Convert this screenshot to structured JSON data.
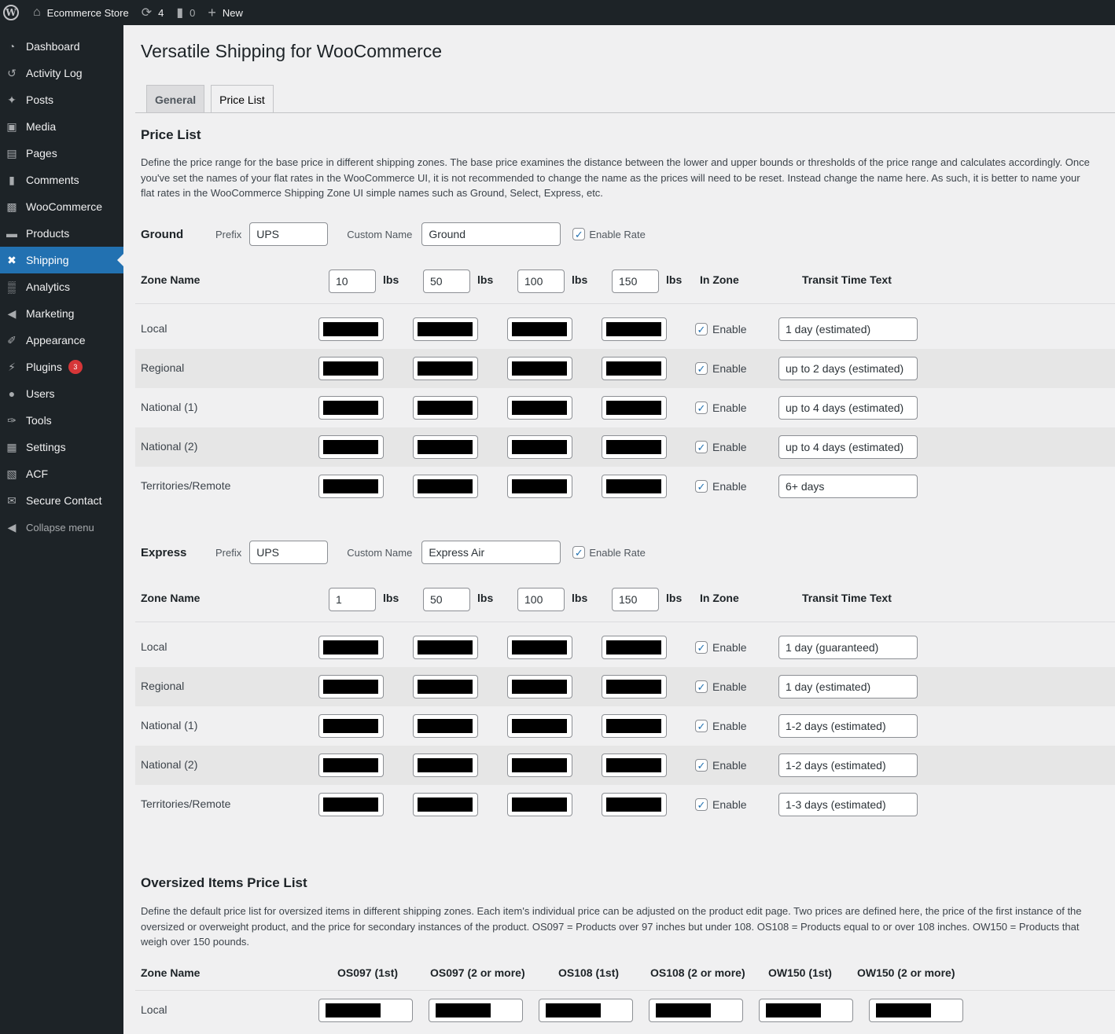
{
  "adminbar": {
    "site_name": "Ecommerce Store",
    "updates_count": "4",
    "comments_count": "0",
    "new_label": "New"
  },
  "sidebar": {
    "items": [
      {
        "label": "Dashboard",
        "icon": "dashboard-icon"
      },
      {
        "label": "Activity Log",
        "icon": "history-icon"
      },
      {
        "label": "Posts",
        "icon": "pushpin-icon"
      },
      {
        "label": "Media",
        "icon": "media-icon"
      },
      {
        "label": "Pages",
        "icon": "pages-icon"
      },
      {
        "label": "Comments",
        "icon": "comment-icon"
      },
      {
        "label": "WooCommerce",
        "icon": "woo-icon"
      },
      {
        "label": "Products",
        "icon": "archive-icon"
      },
      {
        "label": "Shipping",
        "icon": "airplane-icon",
        "current": true
      },
      {
        "label": "Analytics",
        "icon": "bar-chart-icon"
      },
      {
        "label": "Marketing",
        "icon": "megaphone-icon"
      },
      {
        "label": "Appearance",
        "icon": "brush-icon"
      },
      {
        "label": "Plugins",
        "icon": "plug-icon",
        "badge": "3"
      },
      {
        "label": "Users",
        "icon": "user-icon"
      },
      {
        "label": "Tools",
        "icon": "wrench-icon"
      },
      {
        "label": "Settings",
        "icon": "settings-icon"
      },
      {
        "label": "ACF",
        "icon": "acf-icon"
      },
      {
        "label": "Secure Contact",
        "icon": "email-icon"
      }
    ],
    "collapse_label": "Collapse menu"
  },
  "page": {
    "title": "Versatile Shipping for WooCommerce",
    "tabs": [
      "General",
      "Price List"
    ],
    "active_tab": "Price List"
  },
  "price_list": {
    "heading": "Price List",
    "description": "Define the price range for the base price in different shipping zones. The base price examines the distance between the lower and upper bounds or thresholds of the price range and calculates accordingly. Once you've set the names of your flat rates in the WooCommerce UI, it is not recommended to change the name as the prices will need to be reset. Instead change the name here. As such, it is better to name your flat rates in the WooCommerce Shipping Zone UI simple names such as Ground, Select, Express, etc."
  },
  "labels": {
    "prefix": "Prefix",
    "custom_name": "Custom Name",
    "enable_rate": "Enable Rate",
    "zone_name": "Zone Name",
    "lbs": "lbs",
    "in_zone": "In Zone",
    "transit_time_text": "Transit Time Text",
    "enable": "Enable"
  },
  "rates": [
    {
      "name": "Ground",
      "prefix": "UPS",
      "custom_name": "Ground",
      "enabled": true,
      "weights": [
        "10",
        "50",
        "100",
        "150"
      ],
      "zones": [
        {
          "name": "Local",
          "in_zone": true,
          "transit": "1 day (estimated)"
        },
        {
          "name": "Regional",
          "in_zone": true,
          "transit": "up to 2 days (estimated)"
        },
        {
          "name": "National (1)",
          "in_zone": true,
          "transit": "up to 4 days (estimated)"
        },
        {
          "name": "National (2)",
          "in_zone": true,
          "transit": "up to 4 days (estimated)"
        },
        {
          "name": "Territories/Remote",
          "in_zone": true,
          "transit": "6+ days"
        }
      ]
    },
    {
      "name": "Express",
      "prefix": "UPS",
      "custom_name": "Express Air",
      "enabled": true,
      "weights": [
        "1",
        "50",
        "100",
        "150"
      ],
      "zones": [
        {
          "name": "Local",
          "in_zone": true,
          "transit": "1 day (guaranteed)"
        },
        {
          "name": "Regional",
          "in_zone": true,
          "transit": "1 day (estimated)"
        },
        {
          "name": "National (1)",
          "in_zone": true,
          "transit": "1-2 days (estimated)"
        },
        {
          "name": "National (2)",
          "in_zone": true,
          "transit": "1-2 days (estimated)"
        },
        {
          "name": "Territories/Remote",
          "in_zone": true,
          "transit": "1-3 days (estimated)"
        }
      ]
    }
  ],
  "oversized": {
    "heading": "Oversized Items Price List",
    "description": "Define the default price list for oversized items in different shipping zones. Each item's individual price can be adjusted on the product edit page. Two prices are defined here, the price of the first instance of the oversized or overweight product, and the price for secondary instances of the product. OS097 = Products over 97 inches but under 108. OS108 = Products equal to or over 108 inches. OW150 = Products that weigh over 150 pounds.",
    "columns": [
      "Zone Name",
      "OS097 (1st)",
      "OS097 (2 or more)",
      "OS108 (1st)",
      "OS108 (2 or more)",
      "OW150 (1st)",
      "OW150 (2 or more)"
    ],
    "rows": [
      {
        "name": "Local"
      }
    ]
  },
  "colors": {
    "admin_dark": "#1d2327",
    "accent": "#2271b1",
    "badge": "#d63638",
    "background": "#f0f0f1"
  }
}
